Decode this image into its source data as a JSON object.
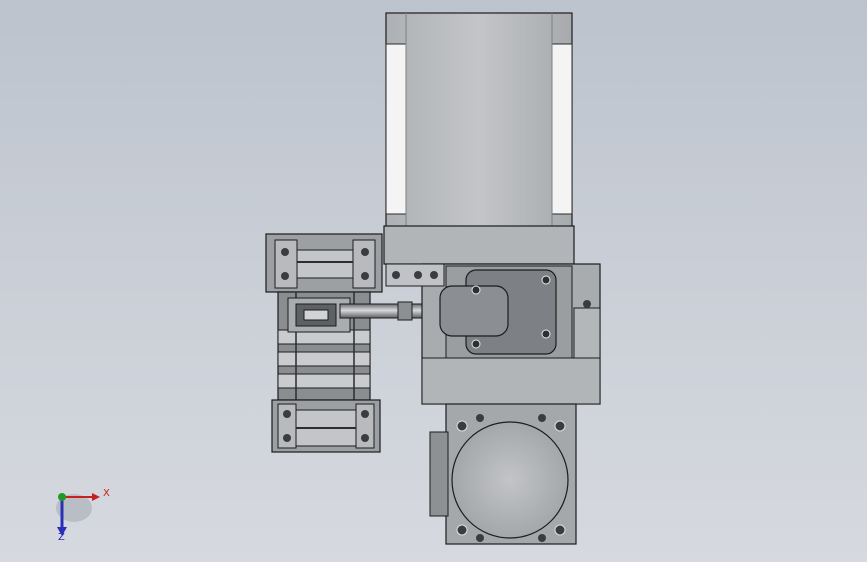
{
  "triad": {
    "x_label": "X",
    "z_label": "Z",
    "colors": {
      "x": "#c8201e",
      "y": "#1f9a2a",
      "z": "#2a2fb8"
    }
  },
  "colors": {
    "background_top": "#bcc3cd",
    "background_bottom": "#d6d9df",
    "part_light": "#b9bcbf",
    "part_mid": "#8e9194",
    "part_dark": "#4d5054",
    "edge": "#1c1c1e",
    "highlight": "#f6f6f6"
  }
}
